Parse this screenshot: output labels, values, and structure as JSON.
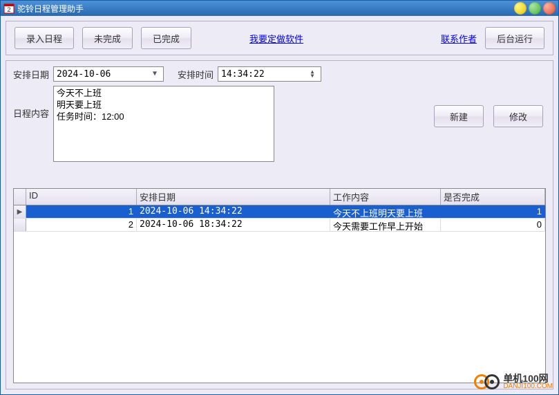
{
  "window": {
    "title": "驼铃日程管理助手"
  },
  "toolbar": {
    "enter": "录入日程",
    "incomplete": "未完成",
    "complete": "已完成",
    "custom_link": "我要定做软件",
    "contact_link": "联系作者",
    "background": "后台运行"
  },
  "form": {
    "date_label": "安排日期",
    "date_value": "2024-10-06",
    "time_label": "安排时间",
    "time_value": "14:34:22",
    "content_label": "日程内容",
    "content_value": "今天不上班\n明天要上班\n任务时间：12:00",
    "new_btn": "新建",
    "edit_btn": "修改"
  },
  "grid": {
    "columns": {
      "id": "ID",
      "date": "安排日期",
      "work": "工作内容",
      "done": "是否完成"
    },
    "rows": [
      {
        "id": "1",
        "date": "2024-10-06 14:34:22",
        "work": "今天不上班明天要上班",
        "done": "1",
        "selected": true
      },
      {
        "id": "2",
        "date": "2024-10-06 18:34:22",
        "work": "今天需要工作早上开始",
        "done": "0",
        "selected": false
      }
    ]
  },
  "footer": {
    "logo_cn": "单机100网",
    "logo_en": "DANJI100.COM"
  }
}
